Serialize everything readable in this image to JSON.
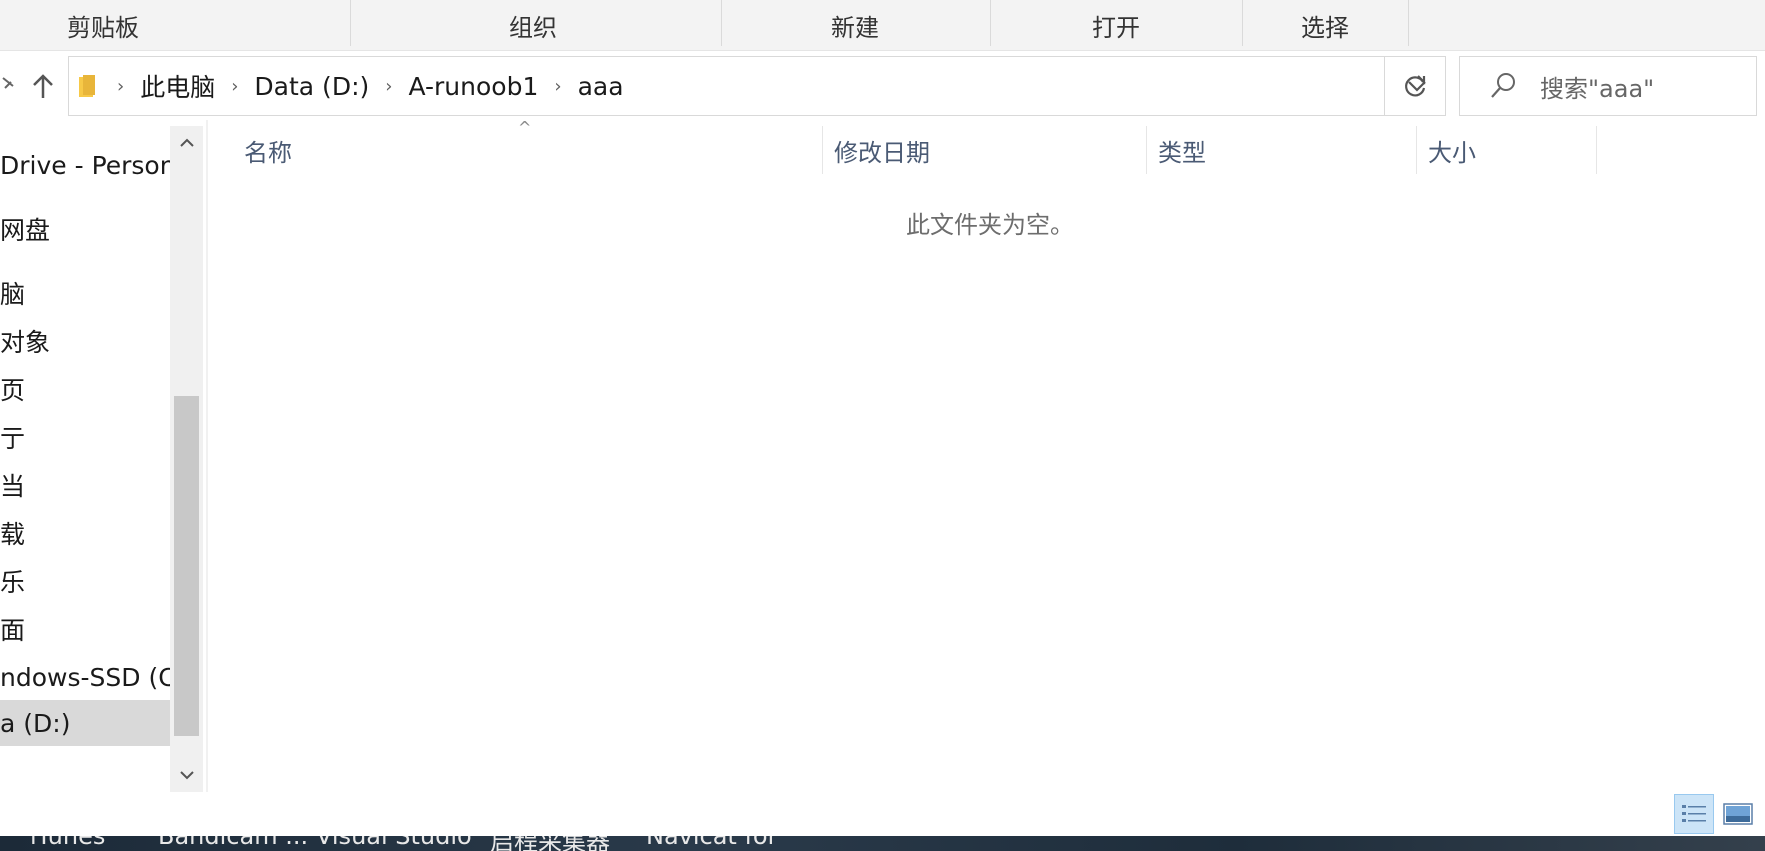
{
  "ribbon": {
    "groups": [
      "剪贴板",
      "组织",
      "新建",
      "打开",
      "选择"
    ]
  },
  "address": {
    "crumbs": [
      "此电脑",
      "Data (D:)",
      "A-runoob1",
      "aaa"
    ]
  },
  "search": {
    "placeholder": "搜索\"aaa\""
  },
  "nav_pane": {
    "items": [
      {
        "label": "Drive - Persona"
      },
      {
        "label": "网盘"
      },
      {
        "label": "脑"
      },
      {
        "label": "对象"
      },
      {
        "label": "页"
      },
      {
        "label": "亍"
      },
      {
        "label": "当"
      },
      {
        "label": "载"
      },
      {
        "label": "乐"
      },
      {
        "label": "面"
      },
      {
        "label": "ndows-SSD (C:)"
      },
      {
        "label": "a (D:)"
      }
    ],
    "selected_index": 11
  },
  "columns": [
    "名称",
    "修改日期",
    "类型",
    "大小"
  ],
  "content": {
    "empty_message": "此文件夹为空。"
  },
  "taskbar": {
    "items": [
      "iTunes",
      "Bandicam ...",
      "Visual Studio",
      "启程采集器",
      "Navicat for"
    ]
  },
  "icons": {
    "back": "chevron-left-icon",
    "up": "up-arrow-icon",
    "folder": "folder-icon",
    "dropdown": "chevron-down-icon",
    "refresh": "refresh-icon",
    "search": "search-icon"
  },
  "colors": {
    "selection": "#d9d9d9",
    "column_header": "#4a5a74",
    "folder": "#f7c948"
  }
}
